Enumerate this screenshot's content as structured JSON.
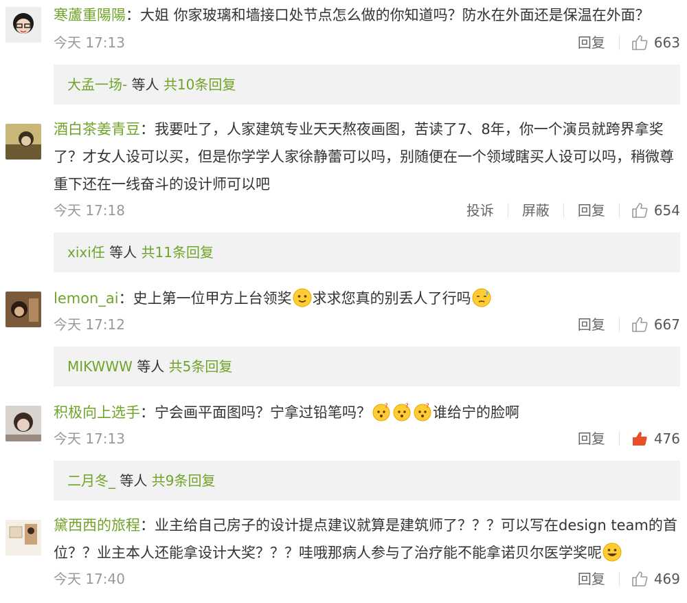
{
  "comments": [
    {
      "user": "寒蘆重陽陽",
      "colon": "：",
      "text": "大姐 你家玻璃和墙接口处节点怎么做的你知道吗？防水在外面还是保温在外面？",
      "time": "今天 17:13",
      "actions": [
        "回复"
      ],
      "likes": "663",
      "liked": false,
      "reply_user": "大孟一场-",
      "reply_mid": " 等人 ",
      "reply_count": "共10条回复"
    },
    {
      "user": "酒白茶姜青豆",
      "colon": "：",
      "text_lines": [
        "我要吐了，人家建筑专业天天熬夜画图，苦读了7、8年，你一个演员就跨界拿奖",
        "了？才女人设可以买，但是你学学人家徐静蕾可以吗，别随便在一个领域瞎买人设可以吗，稍微尊",
        "重下还在一线奋斗的设计师可以吧"
      ],
      "time": "今天 17:18",
      "actions": [
        "投诉",
        "屏蔽",
        "回复"
      ],
      "likes": "654",
      "liked": false,
      "reply_user": "xixi任",
      "reply_mid": " 等人 ",
      "reply_count": "共11条回复"
    },
    {
      "user": "lemon_ai",
      "colon": "：",
      "text_a": "史上第一位甲方上台领奖",
      "text_b": "求求您真的别丢人了行吗",
      "time": "今天 17:12",
      "actions": [
        "回复"
      ],
      "likes": "667",
      "liked": false,
      "reply_user": "MIKWWW",
      "reply_mid": " 等人 ",
      "reply_count": "共5条回复"
    },
    {
      "user": "积极向上选手",
      "colon": "：",
      "text_a": "宁会画平面图吗？宁拿过铅笔吗？",
      "text_b": "谁给宁的脸啊",
      "time": "今天 17:13",
      "actions": [
        "回复"
      ],
      "likes": "476",
      "liked": true,
      "reply_user": "二月冬_",
      "reply_mid": " 等人 ",
      "reply_count": "共9条回复"
    },
    {
      "user": "黛西西的旅程",
      "colon": "：",
      "text_lines": [
        "业主给自己房子的设计提点建议就算是建筑师了？？？可以写在design team的首",
        "位？？业主本人还能拿设计大奖？？？哇哦那病人参与了治疗能不能拿诺贝尔医学奖呢"
      ],
      "time": "今天 17:40",
      "actions": [
        "回复"
      ],
      "likes": "469",
      "liked": false
    }
  ],
  "colors": {
    "username": "#6fa428",
    "liked": "#e8502c",
    "meta": "#999999"
  }
}
